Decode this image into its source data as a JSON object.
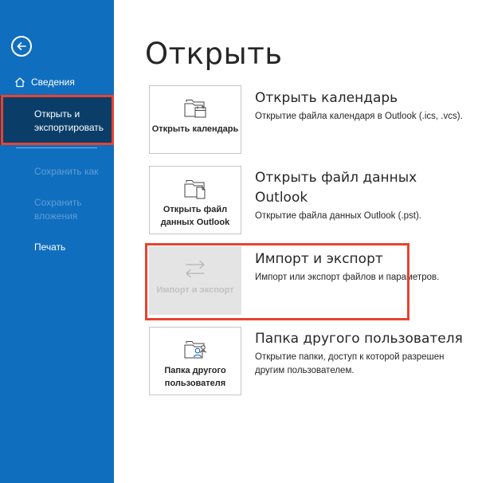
{
  "sidebar": {
    "background": "#106ebe",
    "selected_background": "#0a3e69",
    "highlight_color": "#e8432f",
    "items": [
      {
        "label": "Сведения",
        "icon": "home-icon"
      },
      {
        "label": "Открыть и экспортировать"
      },
      {
        "label": "Сохранить как"
      },
      {
        "label": "Сохранить вложения"
      },
      {
        "label": "Печать"
      }
    ]
  },
  "main": {
    "title": "Открыть",
    "options": [
      {
        "tile_label": "Открыть календарь",
        "title": "Открыть календарь",
        "description": "Открытие файла календаря в Outlook (.ics, .vcs).",
        "icon": "calendar-folder-icon"
      },
      {
        "tile_label": "Открыть файл данных Outlook",
        "title": "Открыть файл данных Outlook",
        "description": "Открытие файла данных Outlook (.pst).",
        "icon": "data-file-folder-icon"
      },
      {
        "tile_label": "Импорт и экспорт",
        "title": "Импорт и экспорт",
        "description": "Импорт или экспорт файлов и параметров.",
        "icon": "import-export-arrows-icon"
      },
      {
        "tile_label": "Папка другого пользователя",
        "title": "Папка другого пользователя",
        "description": "Открытие папки, доступ к которой разрешен другим пользователем.",
        "icon": "user-folder-icon"
      }
    ]
  }
}
